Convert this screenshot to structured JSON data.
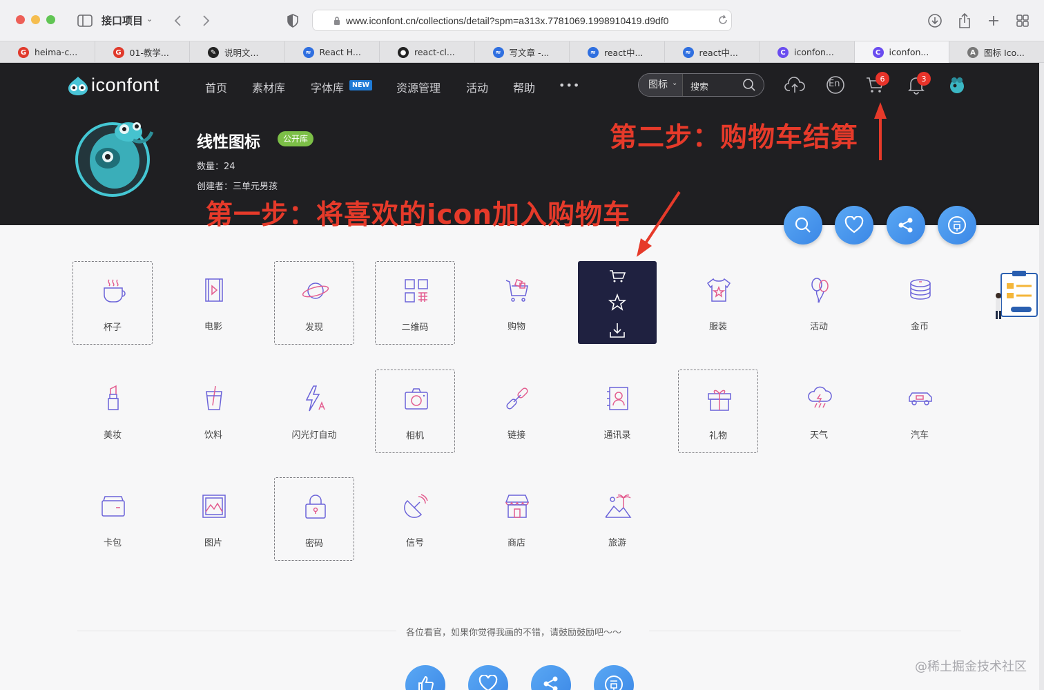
{
  "browser": {
    "project_label": "接口项目",
    "url": "www.iconfont.cn/collections/detail?spm=a313x.7781069.1998910419.d9df0",
    "tabs": [
      {
        "label": "heima-c...",
        "fav_color": "#e0392b",
        "fav_char": "G"
      },
      {
        "label": "01-教学...",
        "fav_color": "#e0392b",
        "fav_char": "G"
      },
      {
        "label": "说明文...",
        "fav_color": "#222222",
        "fav_char": "✎"
      },
      {
        "label": "React H...",
        "fav_color": "#2f6fe0",
        "fav_char": "≈"
      },
      {
        "label": "react-cl...",
        "fav_color": "#222222",
        "fav_char": "●"
      },
      {
        "label": "写文章 -...",
        "fav_color": "#2f6fe0",
        "fav_char": "≈"
      },
      {
        "label": "react中...",
        "fav_color": "#2f6fe0",
        "fav_char": "≈"
      },
      {
        "label": "react中...",
        "fav_color": "#2f6fe0",
        "fav_char": "≈"
      },
      {
        "label": "iconfon...",
        "fav_color": "#6a4cf0",
        "fav_char": "C"
      },
      {
        "label": "iconfon...",
        "fav_color": "#6a4cf0",
        "fav_char": "C"
      },
      {
        "label": "图标 Ico...",
        "fav_color": "#777777",
        "fav_char": "A"
      }
    ]
  },
  "site": {
    "logo_text": "iconfont",
    "nav": [
      "首页",
      "素材库",
      "字体库",
      "资源管理",
      "活动",
      "帮助"
    ],
    "nav_new_badge": "NEW",
    "more": "•••",
    "search_type": "图标",
    "search_placeholder": "搜索",
    "lang_label": "En",
    "cart_count": "6",
    "notice_count": "3"
  },
  "collection": {
    "title": "线性图标",
    "tag": "公开库",
    "count_text": "数量：24",
    "creator_text": "创建者：三单元男孩"
  },
  "annotations": {
    "step1": "第一步：将喜欢的icon加入购物车",
    "step2": "第二步：购物车结算"
  },
  "icons": [
    {
      "label": "杯子",
      "icon": "cup-icon"
    },
    {
      "label": "电影",
      "icon": "film-icon"
    },
    {
      "label": "发现",
      "icon": "planet-icon"
    },
    {
      "label": "二维码",
      "icon": "qrcode-icon"
    },
    {
      "label": "购物",
      "icon": "shopping-cart-icon"
    },
    {
      "label": "",
      "icon": "hover-actions"
    },
    {
      "label": "服装",
      "icon": "tshirt-icon"
    },
    {
      "label": "活动",
      "icon": "balloon-icon"
    },
    {
      "label": "金币",
      "icon": "coins-icon"
    },
    {
      "label": "美妆",
      "icon": "lipstick-icon"
    },
    {
      "label": "饮料",
      "icon": "drink-cup-icon"
    },
    {
      "label": "闪光灯自动",
      "icon": "flash-auto-icon"
    },
    {
      "label": "相机",
      "icon": "camera-icon"
    },
    {
      "label": "链接",
      "icon": "link-icon"
    },
    {
      "label": "通讯录",
      "icon": "contacts-icon"
    },
    {
      "label": "礼物",
      "icon": "gift-icon"
    },
    {
      "label": "天气",
      "icon": "weather-icon"
    },
    {
      "label": "汽车",
      "icon": "car-icon"
    },
    {
      "label": "卡包",
      "icon": "wallet-icon"
    },
    {
      "label": "图片",
      "icon": "picture-icon"
    },
    {
      "label": "密码",
      "icon": "lock-icon"
    },
    {
      "label": "信号",
      "icon": "satellite-icon"
    },
    {
      "label": "商店",
      "icon": "store-icon"
    },
    {
      "label": "旅游",
      "icon": "travel-icon"
    }
  ],
  "footer": {
    "text": "各位看官，如果你觉得我画的不错，请鼓励鼓励吧～～"
  },
  "watermark": "@稀土掘金技术社区",
  "colors": {
    "header_bg": "#1f1f22",
    "annotation": "#e63a2a",
    "fab_blue": "#3b87e6",
    "icon_stroke": "#6b63d9",
    "badge_red": "#e8332a"
  }
}
